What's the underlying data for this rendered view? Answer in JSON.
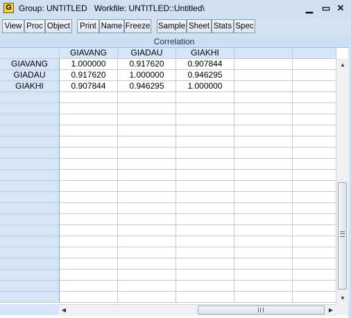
{
  "window": {
    "icon_letter": "G",
    "title": "Group: UNTITLED   Workfile: UNTITLED::Untitled\\",
    "minimize_glyph": "▁",
    "maximize_glyph": "▭",
    "close_glyph": "✕"
  },
  "toolbar": {
    "buttons": [
      "View",
      "Proc",
      "Object",
      "Print",
      "Name",
      "Freeze",
      "Sample",
      "Sheet",
      "Stats",
      "Spec"
    ]
  },
  "view": {
    "title": "Correlation"
  },
  "table": {
    "columns": [
      "GIAVANG",
      "GIADAU",
      "GIAKHI"
    ],
    "rows": [
      {
        "label": "GIAVANG",
        "values": [
          "1.000000",
          "0.917620",
          "0.907844"
        ]
      },
      {
        "label": "GIADAU",
        "values": [
          "0.917620",
          "1.000000",
          "0.946295"
        ]
      },
      {
        "label": "GIAKHI",
        "values": [
          "0.907844",
          "0.946295",
          "1.000000"
        ]
      }
    ]
  },
  "scrollbars": {
    "up_arrow": "▲",
    "down_arrow": "▼",
    "left_arrow": "◀",
    "right_arrow": "▶"
  }
}
